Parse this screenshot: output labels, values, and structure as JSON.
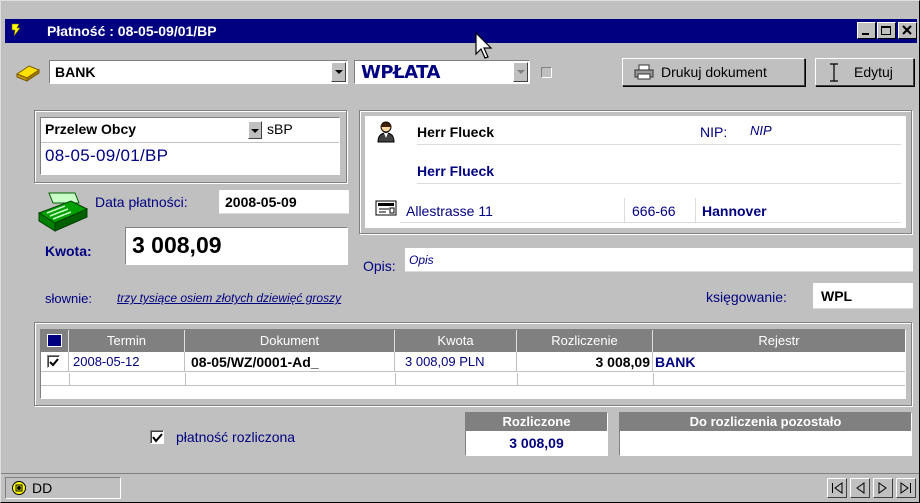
{
  "window": {
    "title": "Płatność : 08-05-09/01/BP"
  },
  "toolbar": {
    "register_value": "BANK",
    "type_value": "WPŁATA",
    "print_label": "Drukuj dokument",
    "edit_label": "Edytuj"
  },
  "document": {
    "kind": "Przelew Obcy",
    "series": "sBP",
    "number": "08-05-09/01/BP",
    "date_label": "Data płatności:",
    "date_value": "2008-05-09",
    "amount_label": "Kwota:",
    "amount_value": "3 008,09",
    "words_label": "słownie:",
    "words_value": "trzy tysiące osiem złotych dziewięć groszy",
    "posting_label": "księgowanie:",
    "posting_value": "WPL"
  },
  "contractor": {
    "name": "Herr Flueck",
    "name2": "Herr Flueck",
    "nip_label": "NIP:",
    "nip_value": "NIP",
    "street": "Allestrasse 11",
    "postal": "666-66",
    "city": "Hannover"
  },
  "description": {
    "label": "Opis:",
    "value": "Opis"
  },
  "table": {
    "columns": [
      "Termin",
      "Dokument",
      "Kwota",
      "Rozliczenie",
      "Rejestr"
    ],
    "rows": [
      {
        "checked": true,
        "termin": "2008-05-12",
        "dokument": "08-05/WZ/0001-Ad_",
        "kwota": "3 008,09",
        "currency": "PLN",
        "rozliczenie": "3 008,09",
        "rejestr": "BANK"
      }
    ]
  },
  "footer": {
    "settled_checkbox_label": "płatność rozliczona",
    "settled_title": "Rozliczone",
    "settled_value": "3 008,09",
    "remaining_title": "Do rozliczenia pozostało",
    "remaining_value": ""
  },
  "statusbar": {
    "user": "DD"
  },
  "colors": {
    "titlebar": "#000080",
    "window_bg": "#c0c0c0",
    "accent_text": "#000080"
  }
}
